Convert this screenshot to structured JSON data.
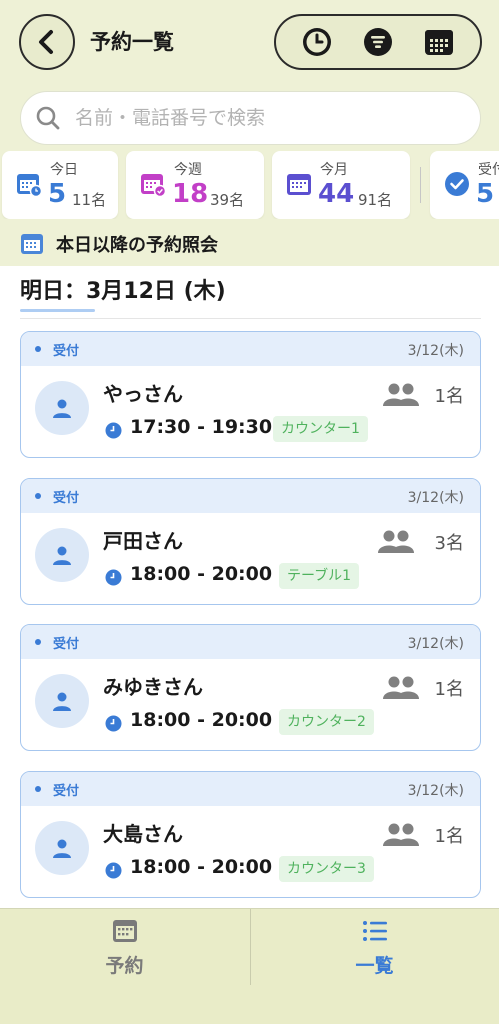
{
  "header": {
    "title": "予約一覧",
    "back_icon": "chevron-left-icon",
    "actions": [
      "clock-icon",
      "filter-icon",
      "calendar-grid-icon"
    ]
  },
  "search": {
    "placeholder": "名前・電話番号で検索"
  },
  "stats": [
    {
      "label": "今日",
      "count": "5",
      "sub": "11名",
      "color": "#3a7bd5",
      "icon": "calendar-clock-icon"
    },
    {
      "label": "今週",
      "count": "18",
      "sub": "39名",
      "color": "#c23fc7",
      "icon": "calendar-check-icon"
    },
    {
      "label": "今月",
      "count": "44",
      "sub": "91名",
      "color": "#5b4fd0",
      "icon": "calendar-icon"
    },
    {
      "label": "受付",
      "count": "5",
      "color": "#3a7bd5",
      "icon": "check-circle-icon"
    }
  ],
  "section": {
    "title": "本日以降の予約照会",
    "icon": "calendar-icon"
  },
  "date_header": "明日：3月12日 (木)",
  "reservations": [
    {
      "status": "受付",
      "date": "3/12(木)",
      "name": "やっさん",
      "party": "1名",
      "time": "17:30 - 19:30",
      "seat": "カウンター1"
    },
    {
      "status": "受付",
      "date": "3/12(木)",
      "name": "戸田さん",
      "party": "3名",
      "time": "18:00 - 20:00",
      "seat": "テーブル1"
    },
    {
      "status": "受付",
      "date": "3/12(木)",
      "name": "みゆきさん",
      "party": "1名",
      "time": "18:00 - 20:00",
      "seat": "カウンター2"
    },
    {
      "status": "受付",
      "date": "3/12(木)",
      "name": "大島さん",
      "party": "1名",
      "time": "18:00 - 20:00",
      "seat": "カウンター3"
    }
  ],
  "tabs": [
    {
      "label": "予約",
      "icon": "calendar-icon",
      "active": false,
      "color": "#7a7a7a"
    },
    {
      "label": "一覧",
      "icon": "list-icon",
      "active": true,
      "color": "#3a7bd5"
    }
  ]
}
